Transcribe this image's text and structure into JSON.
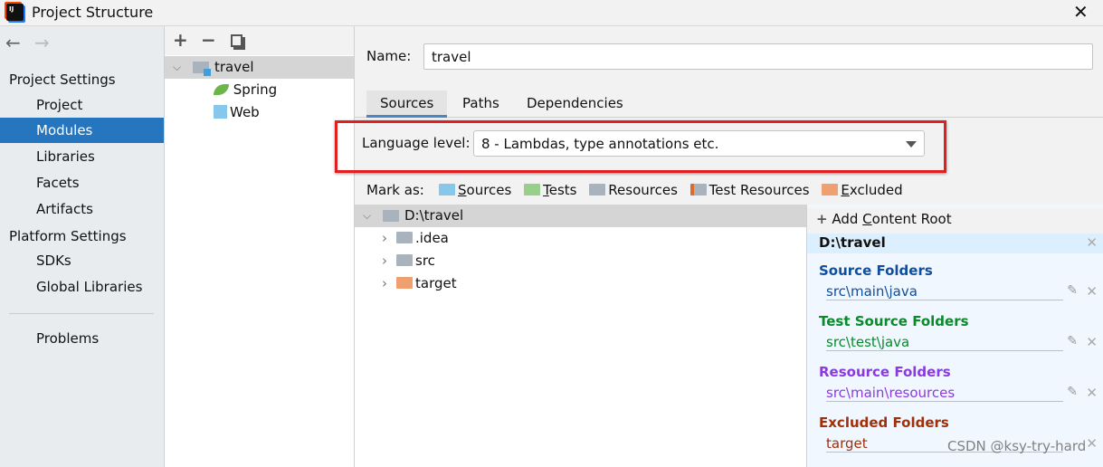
{
  "window": {
    "title": "Project Structure",
    "close_icon": "close-icon"
  },
  "nav": {
    "back": "←",
    "forward": "→"
  },
  "sidebar": {
    "project_settings": "Project Settings",
    "items": [
      {
        "label": "Project"
      },
      {
        "label": "Modules",
        "selected": true
      },
      {
        "label": "Libraries"
      },
      {
        "label": "Facets"
      },
      {
        "label": "Artifacts"
      }
    ],
    "platform_settings": "Platform Settings",
    "platform_items": [
      {
        "label": "SDKs"
      },
      {
        "label": "Global Libraries"
      }
    ],
    "problems": "Problems"
  },
  "modules": {
    "add": "+",
    "remove": "−",
    "module": "travel",
    "facets": [
      {
        "label": "Spring",
        "icon": "spring-leaf-icon"
      },
      {
        "label": "Web",
        "icon": "web-icon"
      }
    ]
  },
  "main": {
    "name_label": "Name:",
    "name_value": "travel",
    "tabs": [
      {
        "label": "Sources",
        "active": true
      },
      {
        "label": "Paths"
      },
      {
        "label": "Dependencies"
      }
    ],
    "language_label": "Language level:",
    "language_value": "8 - Lambdas, type annotations etc.",
    "mark_as": "Mark as:",
    "marks": [
      {
        "first": "S",
        "rest": "ources",
        "color": "#87c7ea"
      },
      {
        "first": "T",
        "rest": "ests",
        "color": "#98cf8a"
      },
      {
        "first": "",
        "rest": "Resources",
        "color": "#a9b3bd"
      },
      {
        "first": "",
        "rest": "Test Resources",
        "color": "#a9b3bd"
      },
      {
        "first": "E",
        "rest": "xcluded",
        "color": "#f0a070"
      }
    ]
  },
  "tree": {
    "root": "D:\\travel",
    "children": [
      {
        "label": ".idea",
        "color": "#a9b3bd"
      },
      {
        "label": "src",
        "color": "#a9b3bd"
      },
      {
        "label": "target",
        "color": "#f0a070"
      }
    ]
  },
  "roots": {
    "add_label_pre": "Add ",
    "add_label_u": "C",
    "add_label_post": "ontent Root",
    "root": "D:\\travel",
    "groups": [
      {
        "title": "Source Folders",
        "path": "src\\main\\java",
        "color": "#0f4e9c"
      },
      {
        "title": "Test Source Folders",
        "path": "src\\test\\java",
        "color": "#0a8a2a"
      },
      {
        "title": "Resource Folders",
        "path": "src\\main\\resources",
        "color": "#8a3ae0"
      },
      {
        "title": "Excluded Folders",
        "path": "target",
        "color": "#a0300a"
      }
    ]
  },
  "watermark": "CSDN @ksy-try-hard",
  "colors": {
    "selection": "#2675bf",
    "highlight_box": "#e02020"
  }
}
